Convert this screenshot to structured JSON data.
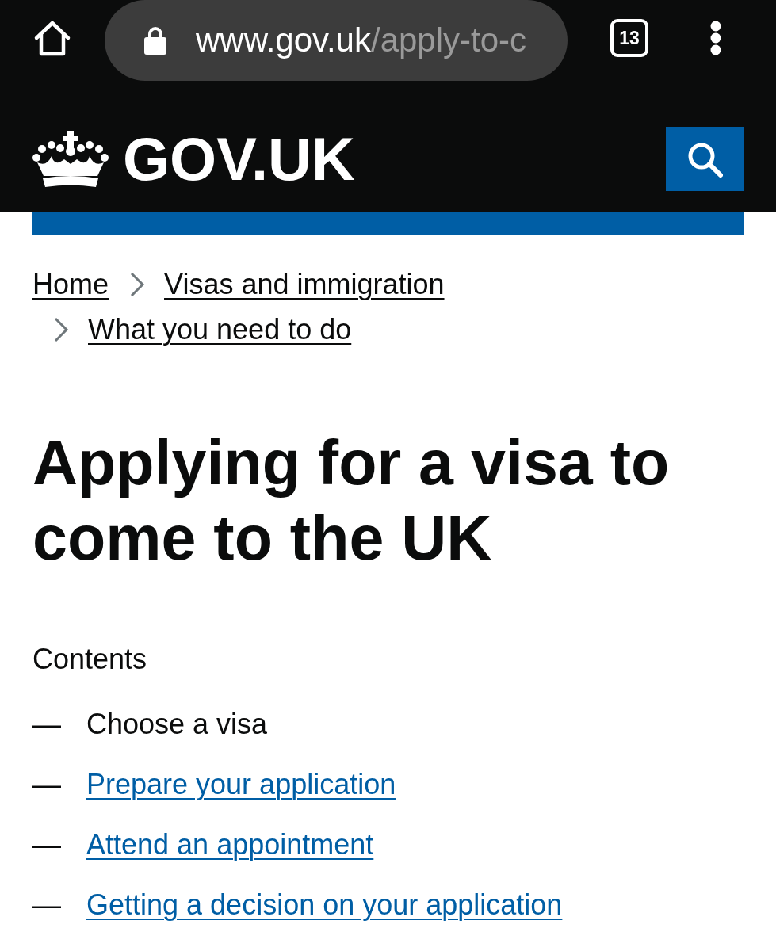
{
  "browser": {
    "url": {
      "host": "www.gov.uk",
      "path": "/apply-to-c"
    },
    "tab_count": "13"
  },
  "header": {
    "logo_text": "GOV.UK"
  },
  "breadcrumbs": [
    {
      "label": "Home"
    },
    {
      "label": "Visas and immigration"
    },
    {
      "label": "What you need to do"
    }
  ],
  "title": "Applying for a visa to come to the UK",
  "contents": {
    "heading": "Contents",
    "items": [
      {
        "marker": "—",
        "label": "Choose a visa",
        "selected": true
      },
      {
        "marker": "—",
        "label": "Prepare your application",
        "selected": false
      },
      {
        "marker": "—",
        "label": "Attend an appointment",
        "selected": false
      },
      {
        "marker": "—",
        "label": "Getting a decision on your application",
        "selected": false
      }
    ]
  }
}
